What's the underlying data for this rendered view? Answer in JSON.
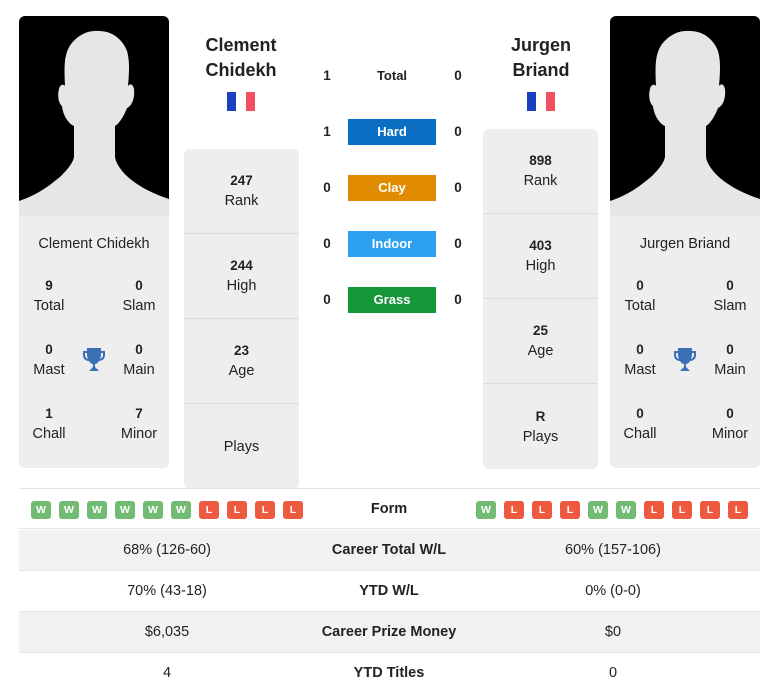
{
  "player1": {
    "name_line1": "Clement",
    "name_line2": "Chidekh",
    "full_name": "Clement Chidekh",
    "flag": "france-flag",
    "titles": {
      "total": {
        "value": "9",
        "label": "Total"
      },
      "slam": {
        "value": "0",
        "label": "Slam"
      },
      "mast": {
        "value": "0",
        "label": "Mast"
      },
      "main": {
        "value": "0",
        "label": "Main"
      },
      "chall": {
        "value": "1",
        "label": "Chall"
      },
      "minor": {
        "value": "7",
        "label": "Minor"
      }
    },
    "stats": [
      {
        "value": "247",
        "label": "Rank"
      },
      {
        "value": "244",
        "label": "High"
      },
      {
        "value": "23",
        "label": "Age"
      },
      {
        "value": "",
        "label": "Plays"
      }
    ],
    "form": [
      "W",
      "W",
      "W",
      "W",
      "W",
      "W",
      "L",
      "L",
      "L",
      "L"
    ]
  },
  "player2": {
    "name_line1": "Jurgen",
    "name_line2": "Briand",
    "full_name": "Jurgen Briand",
    "flag": "france-flag",
    "titles": {
      "total": {
        "value": "0",
        "label": "Total"
      },
      "slam": {
        "value": "0",
        "label": "Slam"
      },
      "mast": {
        "value": "0",
        "label": "Mast"
      },
      "main": {
        "value": "0",
        "label": "Main"
      },
      "chall": {
        "value": "0",
        "label": "Chall"
      },
      "minor": {
        "value": "0",
        "label": "Minor"
      }
    },
    "stats": [
      {
        "value": "898",
        "label": "Rank"
      },
      {
        "value": "403",
        "label": "High"
      },
      {
        "value": "25",
        "label": "Age"
      },
      {
        "value": "R",
        "label": "Plays"
      }
    ],
    "form": [
      "W",
      "L",
      "L",
      "L",
      "W",
      "W",
      "L",
      "L",
      "L",
      "L"
    ]
  },
  "h2h": [
    {
      "label": "Total",
      "p1": "1",
      "p2": "0",
      "color": ""
    },
    {
      "label": "Hard",
      "p1": "1",
      "p2": "0",
      "color": "#0a6fc2"
    },
    {
      "label": "Clay",
      "p1": "0",
      "p2": "0",
      "color": "#e08b00"
    },
    {
      "label": "Indoor",
      "p1": "0",
      "p2": "0",
      "color": "#2da0f0"
    },
    {
      "label": "Grass",
      "p1": "0",
      "p2": "0",
      "color": "#149639"
    }
  ],
  "form_label": "Form",
  "comparison": [
    {
      "p1": "68% (126-60)",
      "label": "Career Total W/L",
      "p2": "60% (157-106)"
    },
    {
      "p1": "70% (43-18)",
      "label": "YTD W/L",
      "p2": "0% (0-0)"
    },
    {
      "p1": "$6,035",
      "label": "Career Prize Money",
      "p2": "$0"
    },
    {
      "p1": "4",
      "label": "YTD Titles",
      "p2": "0"
    }
  ],
  "colors": {
    "win": "#72bb72",
    "loss": "#ee5a40",
    "trophy": "#3b6fb6",
    "flag_blue": "#1a3fbf",
    "flag_red": "#f0505f"
  }
}
